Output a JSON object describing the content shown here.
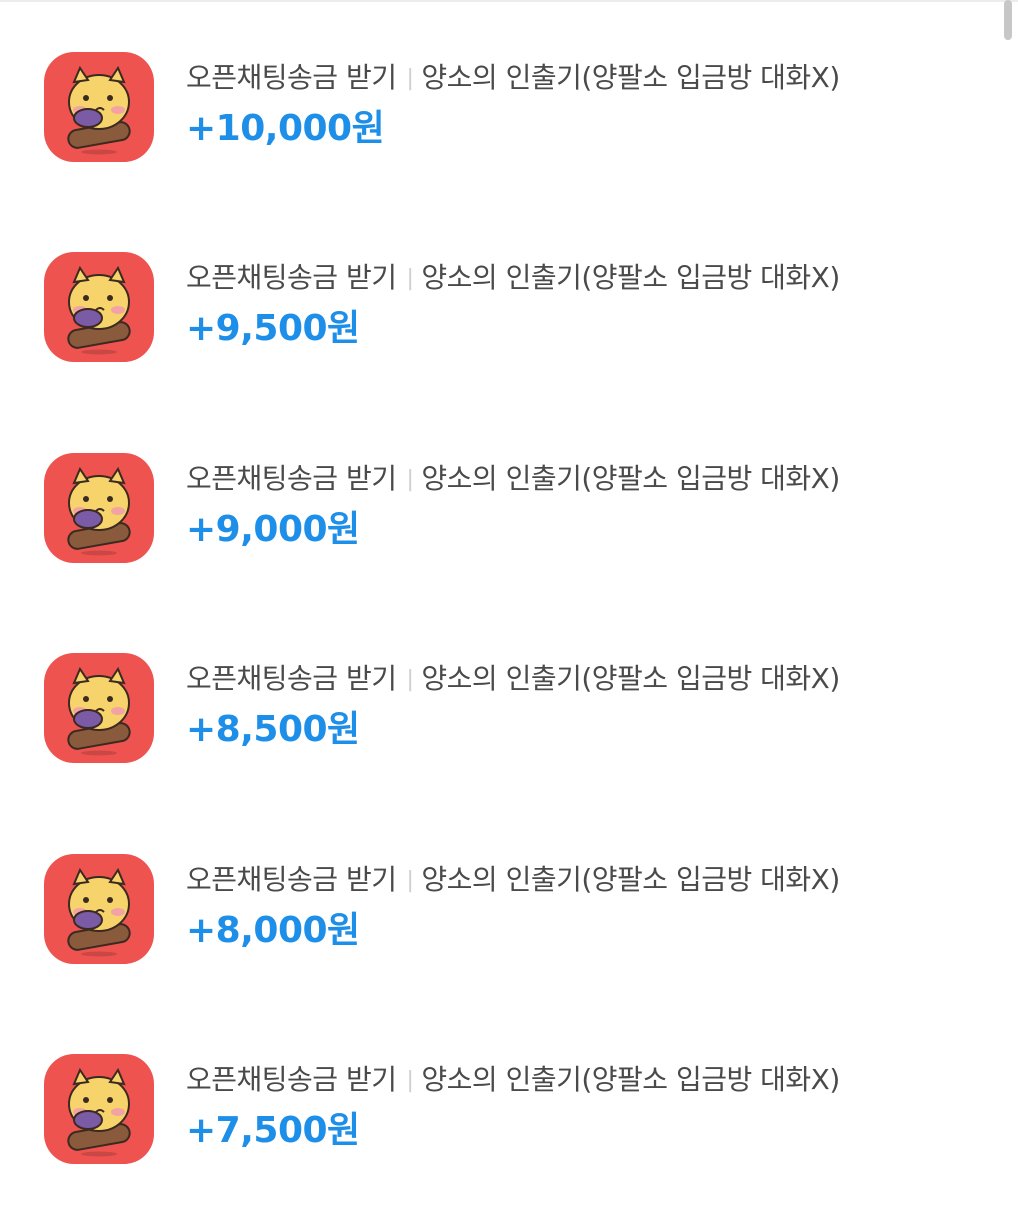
{
  "transactions": [
    {
      "category": "오픈채팅송금 받기",
      "separator": "|",
      "room": "양소의 인출기(양팔소 입금방 대화X)",
      "amount": "+10,000원",
      "icon": "character-sticker-icon"
    },
    {
      "category": "오픈채팅송금 받기",
      "separator": "|",
      "room": "양소의 인출기(양팔소 입금방 대화X)",
      "amount": "+9,500원",
      "icon": "character-sticker-icon"
    },
    {
      "category": "오픈채팅송금 받기",
      "separator": "|",
      "room": "양소의 인출기(양팔소 입금방 대화X)",
      "amount": "+9,000원",
      "icon": "character-sticker-icon"
    },
    {
      "category": "오픈채팅송금 받기",
      "separator": "|",
      "room": "양소의 인출기(양팔소 입금방 대화X)",
      "amount": "+8,500원",
      "icon": "character-sticker-icon"
    },
    {
      "category": "오픈채팅송금 받기",
      "separator": "|",
      "room": "양소의 인출기(양팔소 입금방 대화X)",
      "amount": "+8,000원",
      "icon": "character-sticker-icon"
    },
    {
      "category": "오픈채팅송금 받기",
      "separator": "|",
      "room": "양소의 인출기(양팔소 입금방 대화X)",
      "amount": "+7,500원",
      "icon": "character-sticker-icon"
    }
  ],
  "colors": {
    "avatar_bg": "#ef5350",
    "amount": "#1e8fe9",
    "title": "#4a4a4a",
    "separator": "#cfcfcf"
  }
}
